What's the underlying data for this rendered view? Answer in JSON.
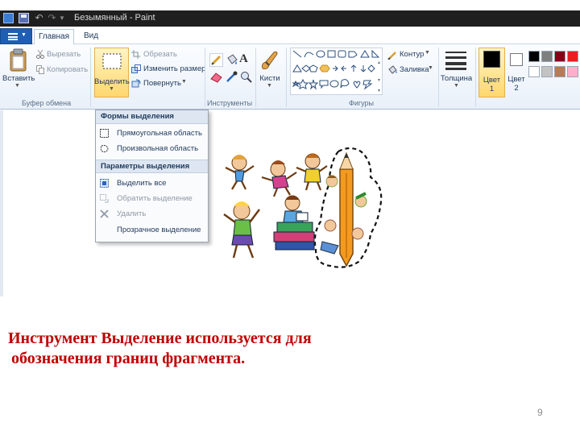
{
  "window": {
    "title": "Безымянный - Paint"
  },
  "tabs": {
    "home": "Главная",
    "view": "Вид"
  },
  "clipboard": {
    "paste": "Вставить",
    "cut": "Вырезать",
    "copy": "Копировать",
    "group": "Буфер обмена"
  },
  "image": {
    "select": "Выделить",
    "crop": "Обрезать",
    "resize": "Изменить размер",
    "rotate": "Повернуть"
  },
  "tools": {
    "group": "Инструменты"
  },
  "brushes": {
    "label": "Кисти"
  },
  "shapes": {
    "outline": "Контур",
    "fill": "Заливка",
    "group": "Фигуры"
  },
  "size": {
    "label": "Толщина"
  },
  "colors": {
    "color1": "Цвет",
    "color1_num": "1",
    "color2": "Цвет",
    "color2_num": "2",
    "palette": [
      "#000000",
      "#7f7f7f",
      "#880015",
      "#ed1c24",
      "#ffffff",
      "#c3c3c3",
      "#b97a57",
      "#ffaec9"
    ]
  },
  "selection_menu": {
    "shapes_header": "Формы выделения",
    "rect": "Прямоугольная область",
    "freeform": "Произвольная область",
    "params_header": "Параметры выделения",
    "select_all": "Выделить все",
    "invert": "Обратить выделение",
    "delete": "Удалить",
    "transparent": "Прозрачное выделение"
  },
  "slide": {
    "caption_line1": "Инструмент Выделение используется для",
    "caption_line2": "обозначения границ фрагмента.",
    "page_number": "9"
  }
}
